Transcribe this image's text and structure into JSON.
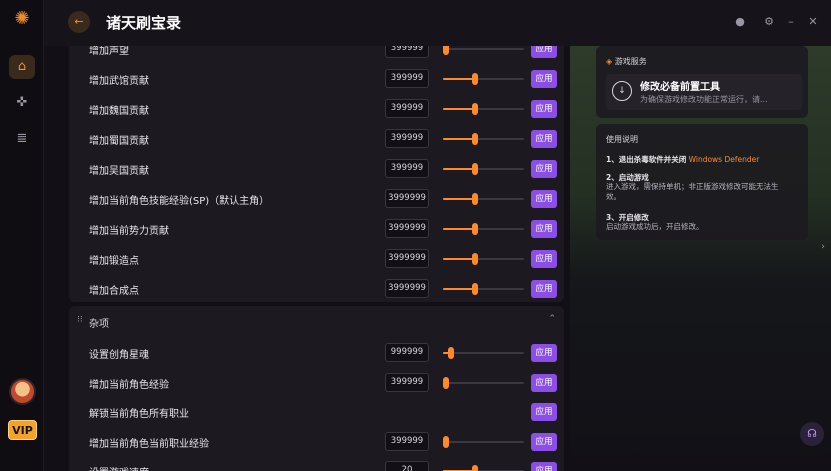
{
  "app": {
    "title": "诸天刷宝录"
  },
  "sidebar": {
    "items": [
      {
        "name": "home",
        "icon": "home-icon",
        "glyph": "⌂",
        "active": true
      },
      {
        "name": "games",
        "icon": "gamepad-icon",
        "glyph": "✜",
        "active": false
      },
      {
        "name": "library",
        "icon": "library-icon",
        "glyph": "≣",
        "active": false
      }
    ],
    "vip_label": "VIP"
  },
  "main": {
    "rows_top": [
      {
        "label": "增加声望",
        "value": "399999",
        "fill": 0.0,
        "apply": "应用"
      },
      {
        "label": "增加武馆贡献",
        "value": "399999",
        "fill": 0.4,
        "apply": "应用"
      },
      {
        "label": "增加魏国贡献",
        "value": "399999",
        "fill": 0.4,
        "apply": "应用"
      },
      {
        "label": "增加蜀国贡献",
        "value": "399999",
        "fill": 0.4,
        "apply": "应用"
      },
      {
        "label": "增加吴国贡献",
        "value": "399999",
        "fill": 0.4,
        "apply": "应用"
      },
      {
        "label": "增加当前角色技能经验(SP)（默认主角）",
        "value": "3999999",
        "fill": 0.4,
        "apply": "应用"
      },
      {
        "label": "增加当前势力贡献",
        "value": "3999999",
        "fill": 0.4,
        "apply": "应用"
      },
      {
        "label": "增加锻造点",
        "value": "3999999",
        "fill": 0.4,
        "apply": "应用"
      },
      {
        "label": "增加合成点",
        "value": "3999999",
        "fill": 0.4,
        "apply": "应用"
      }
    ],
    "misc_section": {
      "title": "杂项",
      "rows": [
        {
          "label": "设置创角星魂",
          "value": "999999",
          "fill": 0.1,
          "apply": "应用",
          "has_input": true
        },
        {
          "label": "增加当前角色经验",
          "value": "399999",
          "fill": 0.0,
          "apply": "应用",
          "has_input": true
        },
        {
          "label": "解锁当前角色所有职业",
          "value": "",
          "fill": 0.0,
          "apply": "应用",
          "has_input": false
        },
        {
          "label": "增加当前角色当前职业经验",
          "value": "399999",
          "fill": 0.0,
          "apply": "应用",
          "has_input": true
        },
        {
          "label": "设置游戏速度",
          "value": "20",
          "fill": 0.4,
          "apply": "应用",
          "has_input": true
        }
      ]
    }
  },
  "right": {
    "service_title": "游戏服务",
    "tool_title": "修改必备前置工具",
    "tool_desc": "为确保游戏修改功能正常运行，请...",
    "usage_title": "使用说明",
    "step1_title": "1、退出杀毒软件并关闭",
    "step1_highlight": "Windows Defender",
    "step2_title": "2、启动游戏",
    "step2_desc1": "进入游戏，需保持单机；非正版游戏修改可能无法生",
    "step2_desc2": "效。",
    "step3_title": "3、开启修改",
    "step3_desc": "启动游戏成功后，开启修改。"
  },
  "colors": {
    "accent": "#ff8a2b",
    "apply": "#8b4ee6",
    "panel": "#1c1920"
  }
}
